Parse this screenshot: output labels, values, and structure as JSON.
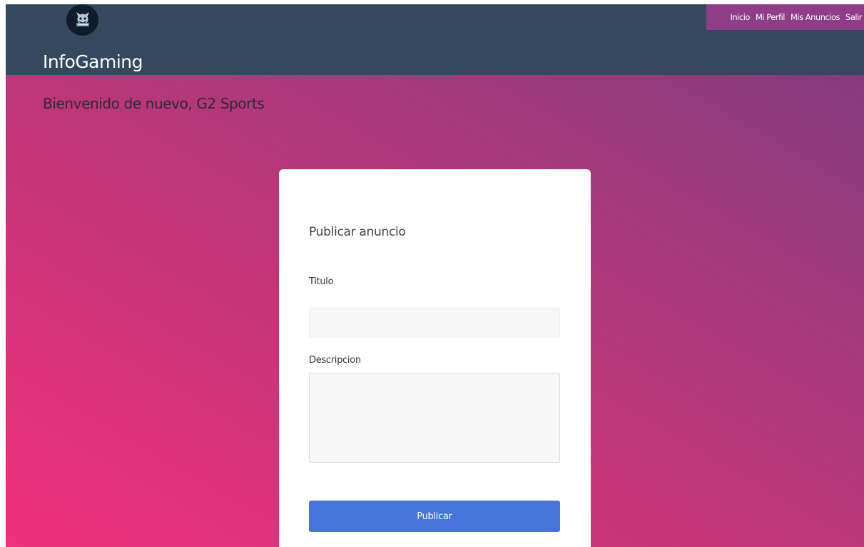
{
  "header": {
    "brand": "InfoGaming",
    "logo_icon": "gaming-mascot-logo",
    "background_color": "#34495e"
  },
  "nav": {
    "items": [
      {
        "label": "Inicio"
      },
      {
        "label": "Mi Perfil"
      },
      {
        "label": "Mis Anuncios"
      },
      {
        "label": "Salir"
      }
    ],
    "background_color": "#8e3d86"
  },
  "main": {
    "welcome": "Bienvenido de nuevo, G2 Sports"
  },
  "form": {
    "title": "Publicar anuncio",
    "titulo_label": "Titulo",
    "titulo_value": "",
    "descripcion_label": "Descripcion",
    "descripcion_value": "",
    "submit_label": "Publicar",
    "submit_color": "#4674db"
  }
}
